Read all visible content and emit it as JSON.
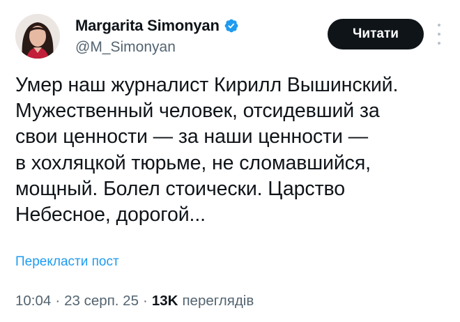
{
  "author": {
    "display_name": "Margarita Simonyan",
    "handle": "@M_Simonyan",
    "verified_color": "#1d9bf0"
  },
  "follow_button": {
    "label": "Читати"
  },
  "tweet": {
    "lines": [
      "Умер наш журналист Кирилл Вышинский.",
      "Мужественный человек, отсидевший за",
      "свои ценности — за наши ценности —",
      "в хохляцкой тюрьме, не сломавшийся,",
      "мощный. Болел стоически. Царство",
      "Небесное, дорогой..."
    ]
  },
  "translate": {
    "label": "Перекласти пост"
  },
  "meta": {
    "time": "10:04",
    "separator": "·",
    "date": "23 серп. 25",
    "views_count": "13K",
    "views_label": "переглядів"
  },
  "colors": {
    "text": "#0f1419",
    "secondary": "#536471",
    "link": "#1d9bf0",
    "button_bg": "#0f1419"
  },
  "icons": [
    "avatar",
    "verified-badge-icon",
    "more-options-icon"
  ]
}
